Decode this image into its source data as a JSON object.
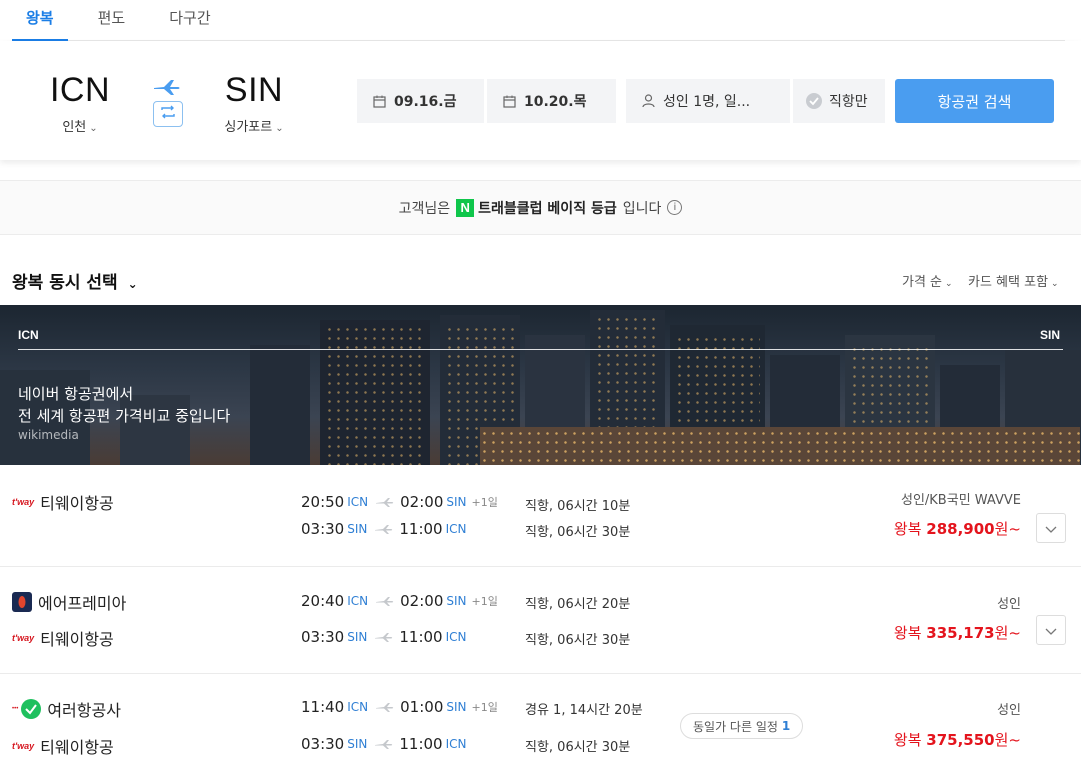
{
  "tabs": [
    {
      "label": "왕복",
      "active": true
    },
    {
      "label": "편도",
      "active": false
    },
    {
      "label": "다구간",
      "active": false
    }
  ],
  "search": {
    "origin": {
      "code": "ICN",
      "name": "인천"
    },
    "destination": {
      "code": "SIN",
      "name": "싱가포르"
    },
    "depart_date": "09.16.금",
    "return_date": "10.20.목",
    "passengers": "성인 1명, 일...",
    "direct_only": "직항만",
    "search_button": "항공권 검색"
  },
  "membership": {
    "prefix": "고객님은",
    "badge": "N",
    "grade": "트래블클럽 베이직 등급",
    "suffix": "입니다"
  },
  "results": {
    "title": "왕복 동시 선택",
    "sort_price": "가격 순",
    "sort_card": "카드 혜택 포함"
  },
  "hero": {
    "origin": "ICN",
    "destination": "SIN",
    "line1": "네이버 항공권에서",
    "line2": "전 세계 항공편 가격비교 중입니다",
    "credit": "wikimedia"
  },
  "colors": {
    "accent": "#1b7ee6",
    "button": "#4a9df0",
    "price": "#e4141d",
    "badge": "#0fc64b"
  },
  "flights": [
    {
      "outbound_airline": "티웨이항공",
      "return_airline": "",
      "outbound": {
        "dep": "20:50",
        "dep_ap": "ICN",
        "arr": "02:00",
        "arr_ap": "SIN",
        "plus": "+1일",
        "duration": "직항, 06시간 10분"
      },
      "inbound": {
        "dep": "03:30",
        "dep_ap": "SIN",
        "arr": "11:00",
        "arr_ap": "ICN",
        "duration": "직항, 06시간 30분"
      },
      "fare_label": "성인/KB국민 WAVVE",
      "price_prefix": "왕복",
      "price": "288,900",
      "currency": "원~"
    },
    {
      "outbound_airline": "에어프레미아",
      "return_airline": "티웨이항공",
      "outbound": {
        "dep": "20:40",
        "dep_ap": "ICN",
        "arr": "02:00",
        "arr_ap": "SIN",
        "plus": "+1일",
        "duration": "직항, 06시간 20분"
      },
      "inbound": {
        "dep": "03:30",
        "dep_ap": "SIN",
        "arr": "11:00",
        "arr_ap": "ICN",
        "duration": "직항, 06시간 30분"
      },
      "fare_label": "성인",
      "price_prefix": "왕복",
      "price": "335,173",
      "currency": "원~"
    },
    {
      "outbound_airline": "여러항공사",
      "return_airline": "티웨이항공",
      "outbound": {
        "dep": "11:40",
        "dep_ap": "ICN",
        "arr": "01:00",
        "arr_ap": "SIN",
        "plus": "+1일",
        "duration": "경유 1, 14시간 20분"
      },
      "inbound": {
        "dep": "03:30",
        "dep_ap": "SIN",
        "arr": "11:00",
        "arr_ap": "ICN",
        "duration": "직항, 06시간 30분"
      },
      "fare_label": "성인",
      "price_prefix": "왕복",
      "price": "375,550",
      "currency": "원~",
      "chip_label": "동일가 다른 일정",
      "chip_count": "1"
    }
  ],
  "logos": {
    "tway": "t'way"
  }
}
